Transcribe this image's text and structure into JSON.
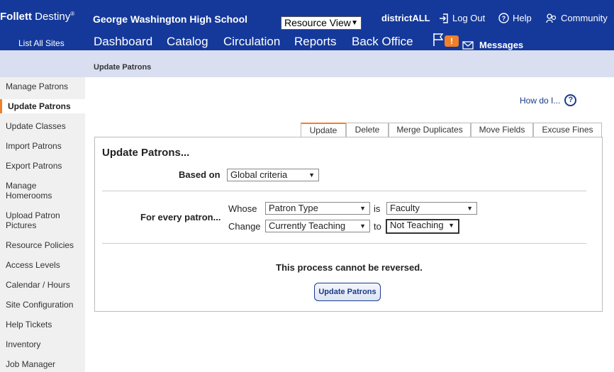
{
  "header": {
    "logo_brand": "Follett",
    "logo_product": "Destiny",
    "logo_mark": "®",
    "school": "George Washington High School",
    "view_select": "Resource View",
    "district": "districtALL",
    "logout": "Log Out",
    "help": "Help",
    "community": "Community",
    "list_sites": "List All Sites",
    "nav": [
      "Dashboard",
      "Catalog",
      "Circulation",
      "Reports",
      "Back Office"
    ],
    "active_nav": "Back Office",
    "badge": "!",
    "messages": "Messages"
  },
  "breadcrumb": "Update Patrons",
  "sidebar": {
    "items": [
      "Manage Patrons",
      "Update Patrons",
      "Update Classes",
      "Import Patrons",
      "Export Patrons",
      "Manage Homerooms",
      "Upload Patron Pictures",
      "Resource Policies",
      "Access Levels",
      "Calendar / Hours",
      "Site Configuration",
      "Help Tickets",
      "Inventory",
      "Job Manager"
    ],
    "active": "Update Patrons"
  },
  "howdoi": "How do I...",
  "tabs": [
    "Update",
    "Delete",
    "Merge Duplicates",
    "Move Fields",
    "Excuse Fines"
  ],
  "active_tab": "Update",
  "form": {
    "title": "Update Patrons...",
    "based_on_label": "Based on",
    "based_on_value": "Global criteria",
    "for_every_label": "For every patron...",
    "whose_label": "Whose",
    "whose_value": "Patron Type",
    "is_label": "is",
    "is_value": "Faculty",
    "change_label": "Change",
    "change_value": "Currently Teaching",
    "to_label": "to",
    "to_value": "Not Teaching",
    "warning": "This process cannot be reversed.",
    "submit": "Update Patrons"
  },
  "colors": {
    "header_bg": "#15399a",
    "accent": "#f0802a",
    "subbar_bg": "#d9dff0",
    "link": "#1a3a8c"
  }
}
